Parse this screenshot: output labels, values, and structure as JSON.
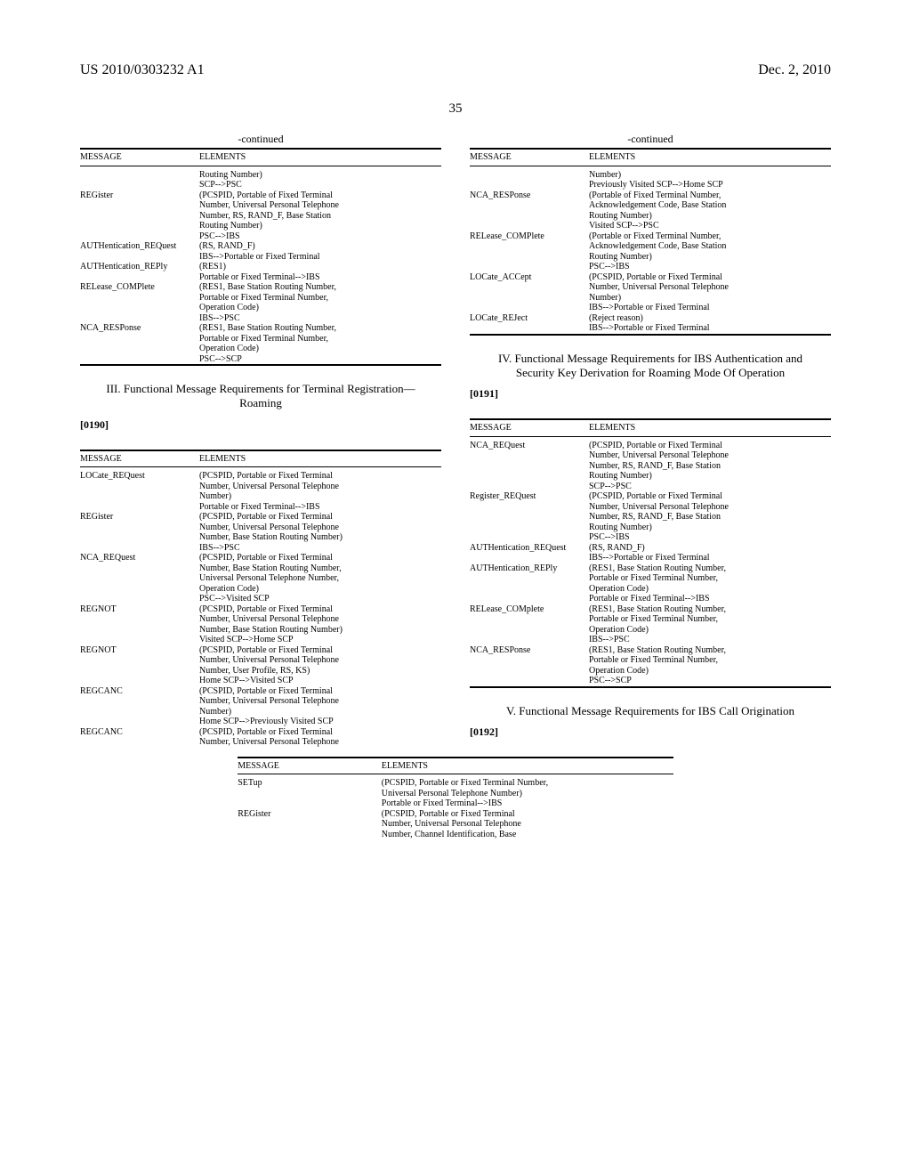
{
  "header": {
    "left": "US 2010/0303232 A1",
    "right": "Dec. 2, 2010",
    "pagenum": "35"
  },
  "continued_label": "-continued",
  "col_message": "MESSAGE",
  "col_elements": "ELEMENTS",
  "sections": {
    "s3": {
      "title": "III. Functional Message Requirements for Terminal Registration—Roaming",
      "paranum": "[0190]"
    },
    "s4": {
      "title": "IV. Functional Message Requirements for IBS Authentication and Security Key Derivation for Roaming Mode Of Operation",
      "paranum": "[0191]"
    },
    "s5": {
      "title": "V. Functional Message Requirements for IBS Call Origination",
      "paranum": "[0192]"
    }
  },
  "tables": {
    "t1": [
      {
        "msg": "",
        "elems": [
          "Routing Number)",
          "SCP-->PSC"
        ]
      },
      {
        "msg": "REGister",
        "elems": [
          "(PCSPID, Portable of Fixed Terminal",
          "Number, Universal Personal Telephone",
          "Number, RS, RAND_F, Base Station",
          "Routing Number)",
          "PSC-->IBS"
        ]
      },
      {
        "msg": "AUTHentication_REQuest",
        "elems": [
          "(RS, RAND_F)",
          "IBS-->Portable or Fixed Terminal"
        ]
      },
      {
        "msg": "AUTHentication_REPly",
        "elems": [
          "(RES1)",
          "Portable or Fixed Terminal-->IBS"
        ]
      },
      {
        "msg": "RELease_COMPlete",
        "elems": [
          "(RES1, Base Station Routing Number,",
          "Portable or Fixed Terminal Number,",
          "Operation Code)",
          "IBS-->PSC"
        ]
      },
      {
        "msg": "NCA_RESPonse",
        "elems": [
          "(RES1, Base Station Routing Number,",
          "Portable or Fixed Terminal Number,",
          "Operation Code)",
          "PSC-->SCP"
        ]
      }
    ],
    "t2": [
      {
        "msg": "",
        "elems": [
          "Number)",
          "Previously Visited SCP-->Home SCP"
        ]
      },
      {
        "msg": "NCA_RESPonse",
        "elems": [
          "(Portable of Fixed Terminal Number,",
          "Acknowledgement Code, Base Station",
          "Routing Number)",
          "Visited SCP-->PSC"
        ]
      },
      {
        "msg": "RELease_COMPlete",
        "elems": [
          "(Portable or Fixed Terminal Number,",
          "Acknowledgement Code, Base Station",
          "Routing Number)",
          "PSC-->IBS"
        ]
      },
      {
        "msg": "LOCate_ACCept",
        "elems": [
          "(PCSPID, Portable or Fixed Terminal",
          "Number, Universal Personal Telephone",
          "Number)",
          "IBS-->Portable or Fixed Terminal"
        ]
      },
      {
        "msg": "LOCate_REJect",
        "elems": [
          "(Reject reason)",
          "IBS-->Portable or Fixed Terminal"
        ]
      }
    ],
    "t3": [
      {
        "msg": "LOCate_REQuest",
        "elems": [
          "(PCSPID, Portable or Fixed Terminal",
          "Number, Universal Personal Telephone",
          "Number)",
          "Portable or Fixed Terminal-->IBS"
        ]
      },
      {
        "msg": "REGister",
        "elems": [
          "(PCSPID, Portable or Fixed Terminal",
          "Number, Universal Personal Telephone",
          "Number, Base Station Routing Number)",
          "IBS-->PSC"
        ]
      },
      {
        "msg": "NCA_REQuest",
        "elems": [
          "(PCSPID, Portable or Fixed Terminal",
          "Number, Base Station Routing Number,",
          "Universal Personal Telephone Number,",
          "Operation Code)",
          "PSC-->Visited SCP"
        ]
      },
      {
        "msg": "REGNOT",
        "elems": [
          "(PCSPID, Portable or Fixed Terminal",
          "Number, Universal Personal Telephone",
          "Number, Base Station Routing Number)",
          "Visited SCP-->Home SCP"
        ]
      },
      {
        "msg": "REGNOT",
        "elems": [
          "(PCSPID, Portable or Fixed Terminal",
          "Number, Universal Personal Telephone",
          "Number, User Profile, RS, KS)",
          "Home SCP-->Visited SCP"
        ]
      },
      {
        "msg": "REGCANC",
        "elems": [
          "(PCSPID, Portable or Fixed Terminal",
          "Number, Universal Personal Telephone",
          "Number)",
          "Home SCP-->Previously Visited SCP"
        ]
      },
      {
        "msg": "REGCANC",
        "elems": [
          "(PCSPID, Portable or Fixed Terminal",
          "Number, Universal Personal Telephone"
        ]
      }
    ],
    "t4": [
      {
        "msg": "NCA_REQuest",
        "elems": [
          "(PCSPID, Portable or Fixed Terminal",
          "Number, Universal Personal Telephone",
          "Number, RS, RAND_F, Base Station",
          "Routing Number)",
          "SCP-->PSC"
        ]
      },
      {
        "msg": "Register_REQuest",
        "elems": [
          "(PCSPID, Portable or Fixed Terminal",
          "Number, Universal Personal Telephone",
          "Number, RS, RAND_F, Base Station",
          "Routing Number)",
          "PSC-->IBS"
        ]
      },
      {
        "msg": "AUTHentication_REQuest",
        "elems": [
          "(RS, RAND_F)",
          "IBS-->Portable or Fixed Terminal"
        ]
      },
      {
        "msg": "AUTHentication_REPly",
        "elems": [
          "(RES1, Base Station Routing Number,",
          "Portable or Fixed Terminal Number,",
          "Operation Code)",
          "Portable or Fixed Terminal-->IBS"
        ]
      },
      {
        "msg": "RELease_COMplete",
        "elems": [
          "(RES1, Base Station Routing Number,",
          "Portable or Fixed Terminal Number,",
          "Operation Code)",
          "IBS-->PSC"
        ]
      },
      {
        "msg": "NCA_RESPonse",
        "elems": [
          "(RES1, Base Station Routing Number,",
          "Portable or Fixed Terminal Number,",
          "Operation Code)",
          "PSC-->SCP"
        ]
      }
    ],
    "t5": [
      {
        "msg": "SETup",
        "elems": [
          "(PCSPID, Portable or Fixed Terminal Number,",
          "Universal Personal Telephone Number)",
          "Portable or Fixed Terminal-->IBS"
        ]
      },
      {
        "msg": "REGister",
        "elems": [
          "(PCSPID, Portable or Fixed Terminal",
          "Number, Universal Personal Telephone",
          "Number, Channel Identification, Base"
        ]
      }
    ]
  }
}
